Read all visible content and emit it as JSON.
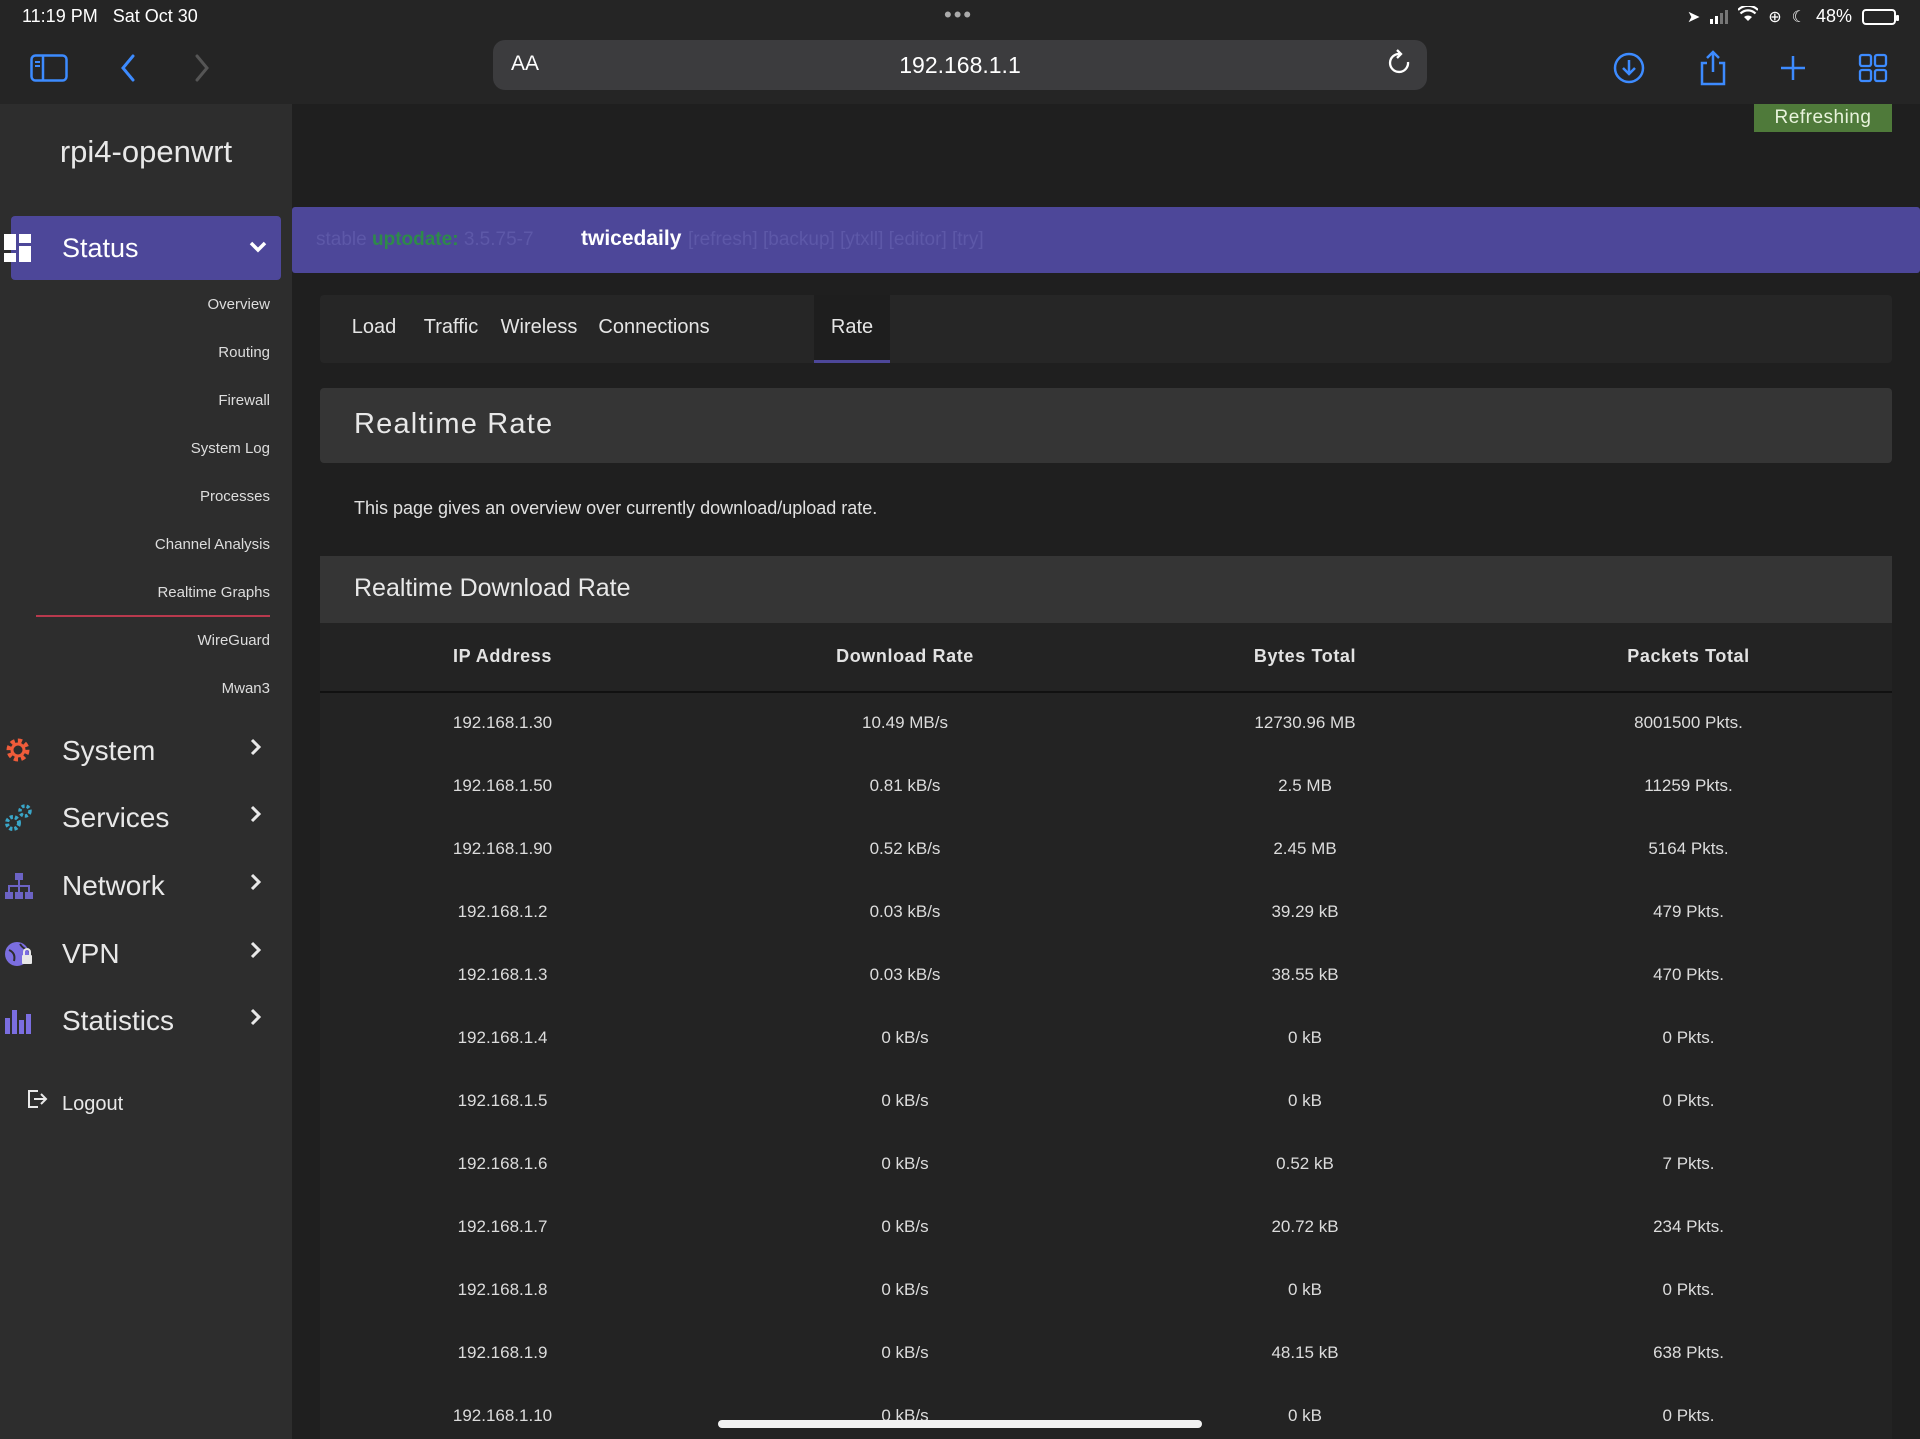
{
  "status_bar": {
    "time": "11:19 PM",
    "date": "Sat Oct 30",
    "battery": "48%",
    "battery_level": 0.48
  },
  "browser": {
    "text_size_label": "AA",
    "url": "192.168.1.1"
  },
  "sidebar": {
    "brand": "rpi4-openwrt",
    "status_menu": {
      "label": "Status",
      "expanded": true
    },
    "status_items": [
      {
        "label": "Overview"
      },
      {
        "label": "Routing"
      },
      {
        "label": "Firewall"
      },
      {
        "label": "System Log"
      },
      {
        "label": "Processes"
      },
      {
        "label": "Channel Analysis"
      },
      {
        "label": "Realtime Graphs",
        "active": true
      },
      {
        "label": "WireGuard"
      },
      {
        "label": "Mwan3"
      }
    ],
    "menus": [
      {
        "label": "System",
        "icon": "gear-icon",
        "color": "#ef5c3a"
      },
      {
        "label": "Services",
        "icon": "cogs-icon",
        "color": "#3aa6c8"
      },
      {
        "label": "Network",
        "icon": "network-icon",
        "color": "#6c63c4"
      },
      {
        "label": "VPN",
        "icon": "globe-lock-icon",
        "color": "#7b6ee0"
      },
      {
        "label": "Statistics",
        "icon": "bar-chart-icon",
        "color": "#7b6ee0"
      }
    ],
    "logout": "Logout"
  },
  "main": {
    "refresh_badge": "Refreshing",
    "banner": {
      "prefix": "stable",
      "status": "uptodate:",
      "version": "3.5.75-7",
      "highlight": "twicedaily",
      "links": "[refresh] [backup] [ytxll] [editor] [try]"
    },
    "tabs": [
      {
        "label": "Load"
      },
      {
        "label": "Traffic"
      },
      {
        "label": "Wireless"
      },
      {
        "label": "Connections"
      },
      {
        "label": "Rate",
        "active": true
      }
    ],
    "page_title": "Realtime Rate",
    "description": "This page gives an overview over currently download/upload rate.",
    "download_section": {
      "title": "Realtime Download Rate",
      "columns": [
        "IP Address",
        "Download Rate",
        "Bytes Total",
        "Packets Total"
      ],
      "rows": [
        [
          "192.168.1.30",
          "10.49 MB/s",
          "12730.96 MB",
          "8001500 Pkts."
        ],
        [
          "192.168.1.50",
          "0.81 kB/s",
          "2.5 MB",
          "11259 Pkts."
        ],
        [
          "192.168.1.90",
          "0.52 kB/s",
          "2.45 MB",
          "5164 Pkts."
        ],
        [
          "192.168.1.2",
          "0.03 kB/s",
          "39.29 kB",
          "479 Pkts."
        ],
        [
          "192.168.1.3",
          "0.03 kB/s",
          "38.55 kB",
          "470 Pkts."
        ],
        [
          "192.168.1.4",
          "0 kB/s",
          "0 kB",
          "0 Pkts."
        ],
        [
          "192.168.1.5",
          "0 kB/s",
          "0 kB",
          "0 Pkts."
        ],
        [
          "192.168.1.6",
          "0 kB/s",
          "0.52 kB",
          "7 Pkts."
        ],
        [
          "192.168.1.7",
          "0 kB/s",
          "20.72 kB",
          "234 Pkts."
        ],
        [
          "192.168.1.8",
          "0 kB/s",
          "0 kB",
          "0 Pkts."
        ],
        [
          "192.168.1.9",
          "0 kB/s",
          "48.15 kB",
          "638 Pkts."
        ],
        [
          "192.168.1.10",
          "0 kB/s",
          "0 kB",
          "0 Pkts."
        ]
      ]
    }
  }
}
